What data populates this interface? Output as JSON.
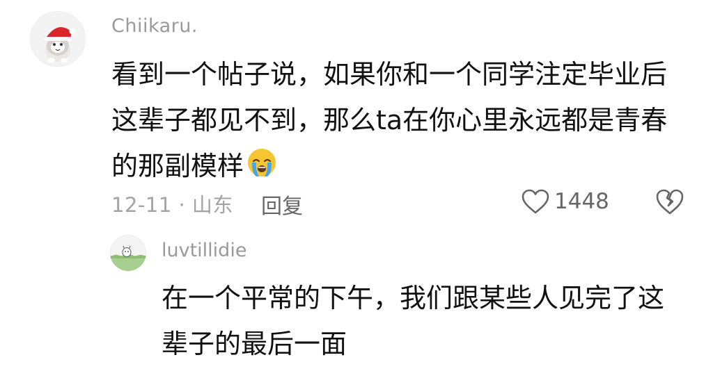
{
  "comment": {
    "username": "Chiikaru.",
    "avatar_icon": "santa-hat-cat-avatar",
    "text_lines": [
      "看到一个帖子说，如果你和一个同学注定毕业后",
      "这辈子都见不到，那么ta在你心里永远都是青春",
      "的那副模样"
    ],
    "emoji": "crying-face-emoji",
    "date_location": "12-11 · 山东",
    "reply_label": "回复",
    "like_count": "1448",
    "like_icon": "heart-outline-icon",
    "dislike_icon": "broken-heart-icon"
  },
  "reply": {
    "username": "luvtillidie",
    "avatar_icon": "grass-creature-avatar",
    "text_lines": [
      "在一个平常的下午，我们跟某些人见完了这",
      "辈子的最后一面"
    ]
  },
  "colors": {
    "username": "#9a9a9a",
    "body_text": "#111111",
    "meta_text": "#a3a3a3",
    "action_text": "#666666",
    "emoji_yellow": "#f7c531",
    "emoji_tears": "#4aa3e8"
  }
}
